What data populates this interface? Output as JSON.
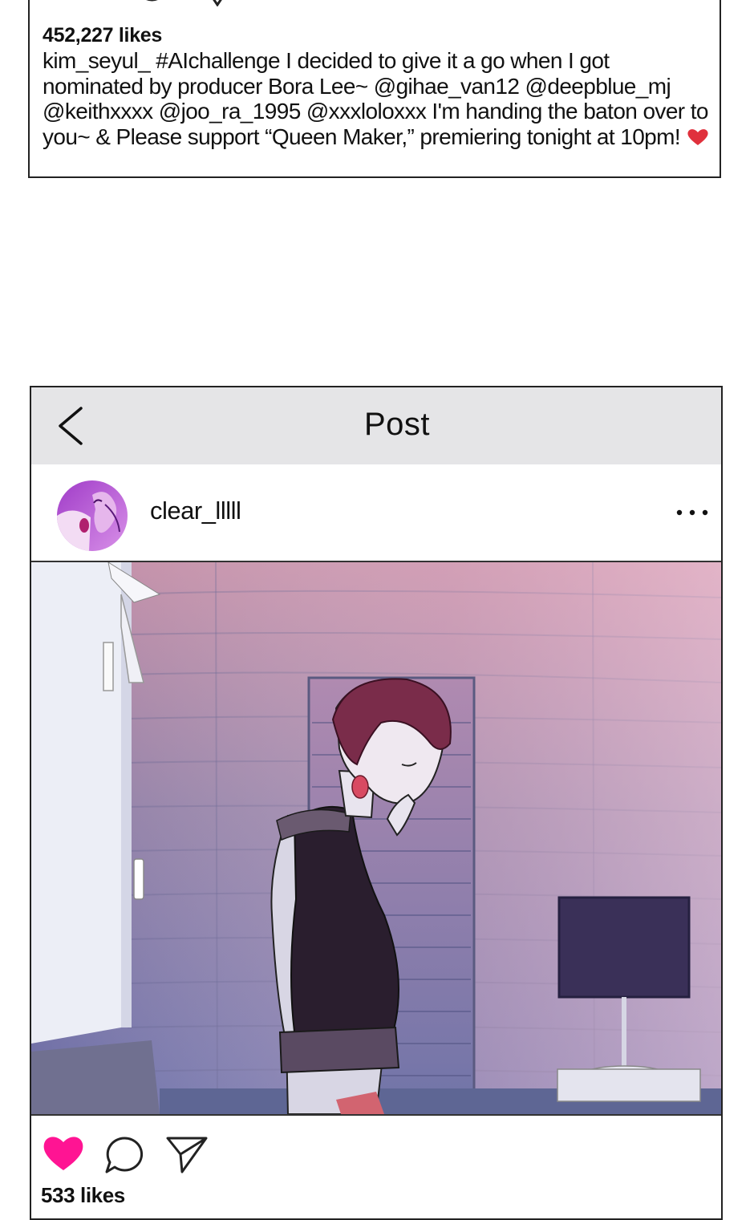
{
  "top_post": {
    "likes": "452,227 likes",
    "caption_user": "kim_seyul_",
    "caption_text": " #AIchallenge I decided to give it a go when I got nominated by producer Bora Lee~ @gihae_van12 @deepblue_mj @keithxxxx @joo_ra_1995 @xxxloloxxx I'm handing the baton over to you~ & Please support “Queen Maker,” premiering tonight at 10pm! ",
    "emoji": "red-heart-icon"
  },
  "post_screen": {
    "title": "Post",
    "back_icon": "chevron-left-icon",
    "username": "clear_lllll",
    "more_icon": "ellipsis-icon",
    "like_icon": "heart-filled-icon",
    "comment_icon": "comment-bubble-icon",
    "share_icon": "paper-plane-icon",
    "likes": "533 likes"
  },
  "colors": {
    "like_heart": "#ff1493",
    "nav_bar": "#e5e5e7",
    "emoji_heart": "#e0303c",
    "photo_tint_top": "#d6a0b4",
    "photo_tint_bottom": "#6a6ea8"
  }
}
